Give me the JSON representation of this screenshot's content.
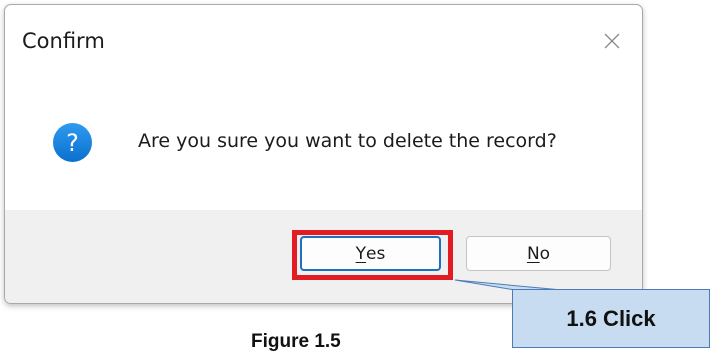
{
  "dialog": {
    "title": "Confirm",
    "close_icon": "close-icon",
    "message_icon": "question-icon",
    "message": "Are you sure you want to delete the record?",
    "buttons": {
      "yes": {
        "accel": "Y",
        "rest": "es"
      },
      "no": {
        "accel": "N",
        "rest": "o"
      }
    }
  },
  "annotation": {
    "callout_text": "1.6 Click",
    "highlight_color": "#e31c23",
    "callout_fill": "#c7dcf0"
  },
  "caption": "Figure 1.5"
}
